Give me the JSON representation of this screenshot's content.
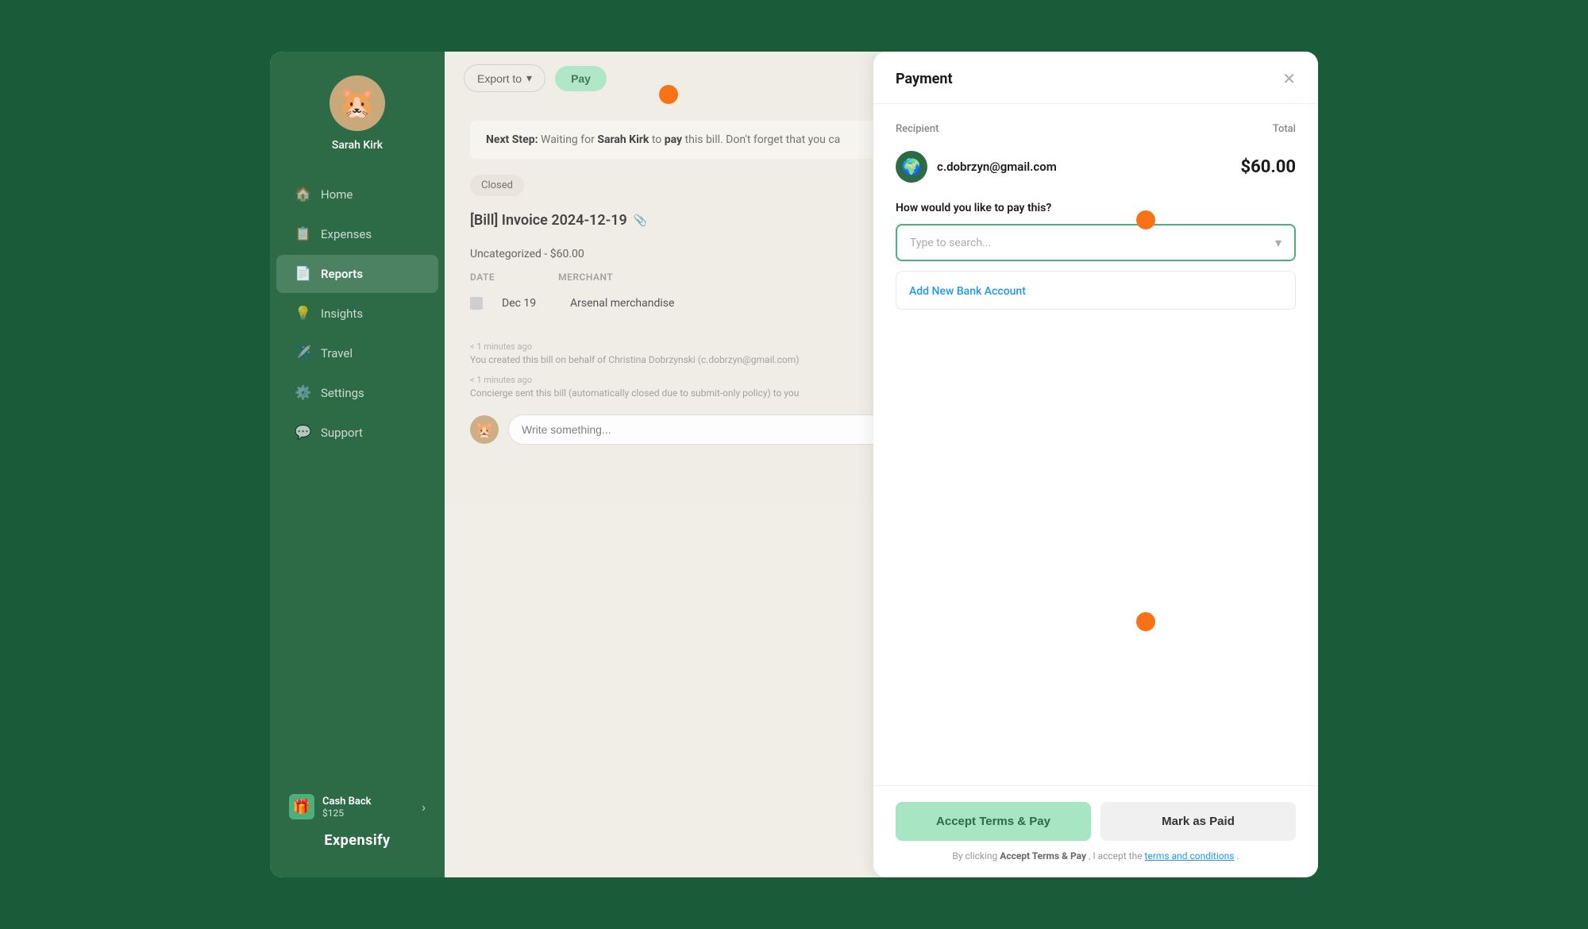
{
  "sidebar": {
    "user": {
      "name": "Sarah Kirk",
      "avatar_emoji": "🐹"
    },
    "nav_items": [
      {
        "id": "home",
        "label": "Home",
        "icon": "🏠",
        "active": false
      },
      {
        "id": "expenses",
        "label": "Expenses",
        "icon": "📋",
        "active": false
      },
      {
        "id": "reports",
        "label": "Reports",
        "icon": "📄",
        "active": true
      },
      {
        "id": "insights",
        "label": "Insights",
        "icon": "💡",
        "active": false
      },
      {
        "id": "travel",
        "label": "Travel",
        "icon": "✈️",
        "active": false
      },
      {
        "id": "settings",
        "label": "Settings",
        "icon": "⚙️",
        "active": false
      },
      {
        "id": "support",
        "label": "Support",
        "icon": "💬",
        "active": false
      }
    ],
    "cashback": {
      "label": "Cash Back",
      "amount": "$125",
      "icon": "🎁"
    },
    "logo": "Expensify"
  },
  "toolbar": {
    "export_label": "Export to",
    "pay_label": "Pay"
  },
  "bill": {
    "next_step_label": "Next Step:",
    "next_step_text": "Waiting for Sarah Kirk to pay this bill. Don't forget that you ca",
    "status": "Closed",
    "invoice_title": "[Bill] Invoice 2024-12-19",
    "section_label": "Uncategorized - $60.00",
    "table_headers": {
      "date": "DATE",
      "merchant": "MERCHANT"
    },
    "expenses": [
      {
        "date": "Dec 19",
        "merchant": "Arsenal merchandise"
      }
    ],
    "activity": [
      {
        "time": "< 1 minutes ago",
        "text": "You created this bill on behalf of Christina Dobrzynski (c.dobrzyn@gmail.com)"
      },
      {
        "time": "< 1 minutes ago",
        "text": "Concierge sent this bill (automatically closed due to submit-only policy) to you"
      }
    ],
    "comment_placeholder": "Write something..."
  },
  "payment": {
    "title": "Payment",
    "recipient_label": "Recipient",
    "total_label": "Total",
    "total_amount": "$60.00",
    "recipient_email": "c.dobrzyn@gmail.com",
    "recipient_avatar": "🌍",
    "pay_method_question": "How would you like to pay this?",
    "search_placeholder": "Type to search...",
    "add_bank_label": "Add New Bank Account",
    "accept_pay_label": "Accept Terms & Pay",
    "mark_paid_label": "Mark as Paid",
    "terms_prefix": "By clicking",
    "terms_bold": "Accept Terms & Pay",
    "terms_middle": ", I accept the",
    "terms_link": "terms and conditions",
    "terms_suffix": "."
  }
}
